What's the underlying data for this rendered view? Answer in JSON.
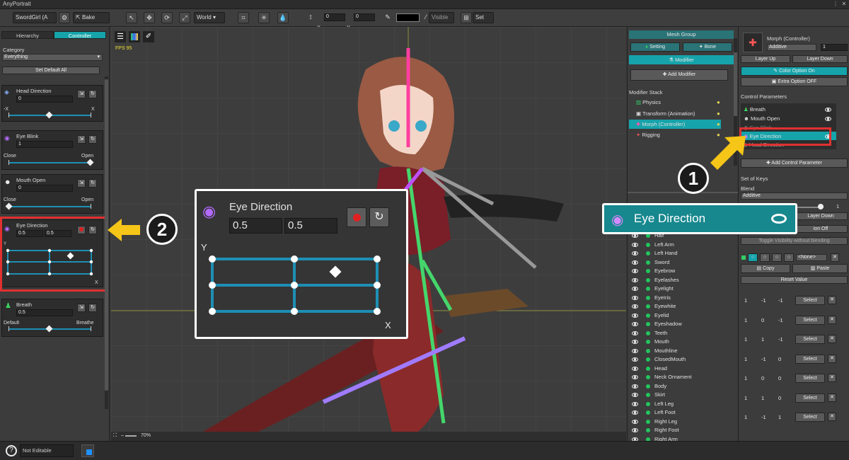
{
  "window": {
    "title": "AnyPortrait"
  },
  "toolbar": {
    "file_label": "SwordGirl (A",
    "bake_label": "Bake",
    "space_value": "World",
    "x_label": "X",
    "x_value": "0",
    "y_label": "Y",
    "y_value": "0",
    "visible_label": "Visible",
    "set_label": "Set"
  },
  "left": {
    "tabs": [
      "Hierarchy",
      "Controller"
    ],
    "category_label": "Category",
    "category_value": "Everything",
    "set_default_label": "Set Default All",
    "params": [
      {
        "name": "Head Direction",
        "values": [
          "0"
        ],
        "min": "-X",
        "max": "X",
        "knob": 0.5
      },
      {
        "name": "Eye Blink",
        "values": [
          "1"
        ],
        "min": "Close",
        "max": "Open",
        "knob": 1.0
      },
      {
        "name": "Mouth Open",
        "values": [
          "0"
        ],
        "min": "Close",
        "max": "Open",
        "knob": 0.0
      },
      {
        "name": "Eye Direction",
        "values": [
          "0.5",
          "0.5"
        ],
        "axis_y": "Y",
        "axis_x": "X"
      },
      {
        "name": "Breath",
        "values": [
          "0.5"
        ],
        "min": "Default",
        "max": "Breathe",
        "knob": 0.5
      }
    ]
  },
  "viewport": {
    "fps": "FPS 95",
    "zoom": "70%"
  },
  "callout_left": {
    "name": "Eye Direction",
    "values": [
      "0.5",
      "0.5"
    ],
    "axis_y": "Y",
    "axis_x": "X",
    "badge": "2"
  },
  "callout_right": {
    "name": "Eye Direction",
    "badge": "1"
  },
  "rp1": {
    "title": "Mesh Group",
    "tabs": [
      "Setting",
      "Bone"
    ],
    "modifier_tab": "Modifier",
    "add_modifier": "Add Modifier",
    "stack_label": "Modifier Stack",
    "stack": [
      "Physics",
      "Transform (Animation)",
      "Morph (Controller)",
      "Rigging"
    ],
    "meshes": [
      "Hair",
      "Left Arm",
      "Left Hand",
      "Sword",
      "Eyebrow",
      "Eyelashes",
      "Eyelight",
      "EyeIris",
      "Eyewhite",
      "Eyelid",
      "Eyeshadow",
      "Teeth",
      "Mouth",
      "Mouthline",
      "ClosedMouth",
      "Head",
      "Neck Ornament",
      "Body",
      "Skirt",
      "Left Leg",
      "Left Foot",
      "Right Leg",
      "Right Foot",
      "Right Arm"
    ]
  },
  "rp2": {
    "modifier_name": "Morph (Controller)",
    "blend_mode": "Additive",
    "layer_value": "1",
    "layer_up": "Layer Up",
    "layer_down": "Layer Down",
    "color_option": "Color Option On",
    "extra_option": "Extra Option OFF",
    "control_params_label": "Control Parameters",
    "control_params": [
      "Breath",
      "Mouth Open",
      "Eye Blink",
      "Eye Direction",
      "Head Direction"
    ],
    "add_control_param": "Add Control Parameter",
    "set_of_keys": "Set of Keys",
    "blend_label": "Blend",
    "blend_value": "Additive",
    "weight_value": "1",
    "layer_down2": "Layer Down",
    "option_off": "ion Off",
    "toggle_visibility": "Toggle Visibility without blending",
    "none_label": "<None>",
    "copy": "Copy",
    "paste": "Paste",
    "reset_value": "Reset Value",
    "keys": [
      [
        "1",
        "-1",
        "-1"
      ],
      [
        "1",
        "0",
        "-1"
      ],
      [
        "1",
        "1",
        "-1"
      ],
      [
        "1",
        "-1",
        "0"
      ],
      [
        "1",
        "0",
        "0"
      ],
      [
        "1",
        "1",
        "0"
      ],
      [
        "1",
        "-1",
        "1"
      ]
    ],
    "select_label": "Select"
  },
  "bottom": {
    "status": "Not Editable"
  }
}
